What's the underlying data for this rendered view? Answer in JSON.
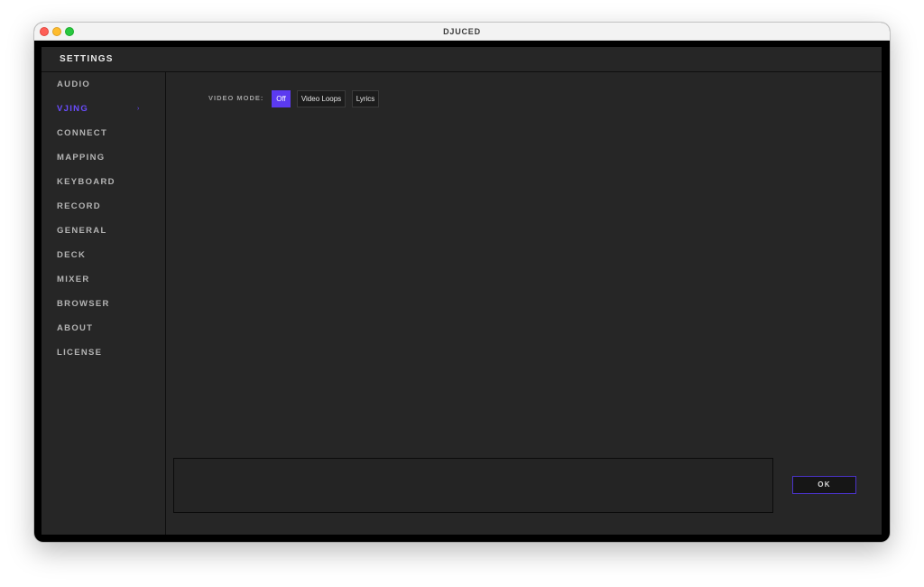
{
  "window": {
    "title": "DJUCED"
  },
  "settings": {
    "title": "SETTINGS"
  },
  "sidebar": {
    "active_arrow": "›",
    "items": [
      {
        "label": "AUDIO"
      },
      {
        "label": "VJING"
      },
      {
        "label": "CONNECT"
      },
      {
        "label": "MAPPING"
      },
      {
        "label": "KEYBOARD"
      },
      {
        "label": "RECORD"
      },
      {
        "label": "GENERAL"
      },
      {
        "label": "DECK"
      },
      {
        "label": "MIXER"
      },
      {
        "label": "BROWSER"
      },
      {
        "label": "ABOUT"
      },
      {
        "label": "LICENSE"
      }
    ]
  },
  "vjing": {
    "video_mode_label": "VIDEO MODE:",
    "options": [
      {
        "label": "Off"
      },
      {
        "label": "Video Loops"
      },
      {
        "label": "Lyrics"
      }
    ],
    "selected": "Off"
  },
  "footer": {
    "ok_label": "OK"
  },
  "colors": {
    "accent": "#5b3af0",
    "active_text": "#6a4cff",
    "panel": "#262626",
    "frame": "#000000"
  }
}
